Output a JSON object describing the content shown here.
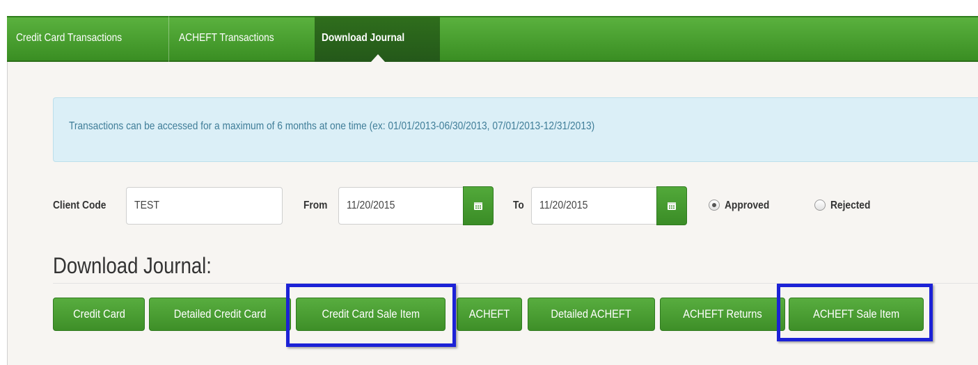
{
  "tabs": [
    {
      "label": "Credit Card Transactions"
    },
    {
      "label": "ACHEFT Transactions"
    },
    {
      "label": "Download Journal"
    }
  ],
  "info": {
    "message": "Transactions can be accessed for a maximum of 6 months at one time (ex: 01/01/2013-06/30/2013, 07/01/2013-12/31/2013)"
  },
  "filters": {
    "client_code_label": "Client Code",
    "client_code_value": "TEST",
    "from_label": "From",
    "from_value": "11/20/2015",
    "to_label": "To",
    "to_value": "11/20/2015",
    "approved_label": "Approved",
    "rejected_label": "Rejected",
    "selected_status": "Approved"
  },
  "download": {
    "heading": "Download Journal:",
    "buttons": [
      {
        "label": "Credit Card"
      },
      {
        "label": "Detailed Credit Card"
      },
      {
        "label": "Credit Card Sale Item"
      },
      {
        "label": "ACHEFT"
      },
      {
        "label": "Detailed ACHEFT"
      },
      {
        "label": "ACHEFT Returns"
      },
      {
        "label": "ACHEFT Sale Item"
      }
    ]
  },
  "colors": {
    "brand_green": "#3e8f28",
    "highlight_blue": "#1c22d6",
    "info_bg": "#dbeff7",
    "info_text": "#3f7d98"
  },
  "icons": {
    "calendar": "calendar-icon"
  }
}
